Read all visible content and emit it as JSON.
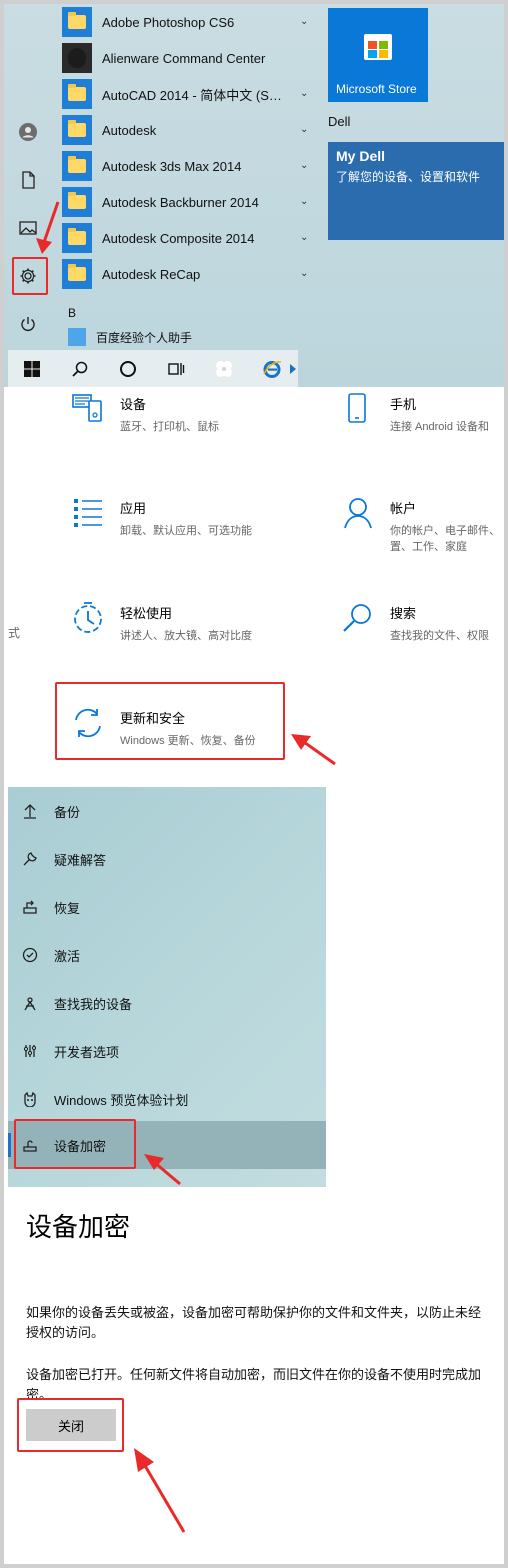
{
  "start_menu": {
    "apps": [
      {
        "label": "Adobe Photoshop CS6",
        "icon": "folder-icon",
        "expandable": true
      },
      {
        "label": "Alienware Command Center",
        "icon": "alienware-icon",
        "expandable": false
      },
      {
        "label": "AutoCAD 2014 - 简体中文 (Si...",
        "icon": "folder-icon",
        "expandable": true
      },
      {
        "label": "Autodesk",
        "icon": "folder-icon",
        "expandable": true
      },
      {
        "label": "Autodesk 3ds Max 2014",
        "icon": "folder-icon",
        "expandable": true
      },
      {
        "label": "Autodesk Backburner 2014",
        "icon": "folder-icon",
        "expandable": true
      },
      {
        "label": "Autodesk Composite 2014",
        "icon": "folder-icon",
        "expandable": true
      },
      {
        "label": "Autodesk ReCap",
        "icon": "folder-icon",
        "expandable": true
      }
    ],
    "section_letter": "B",
    "recent_item": "百度经验个人助手",
    "tiles": {
      "store_label": "Microsoft Store",
      "group_label": "Dell",
      "mydell_title": "My Dell",
      "mydell_subtitle": "了解您的设备、设置和软件"
    },
    "rail_icons": [
      "user-icon",
      "document-icon",
      "pictures-icon",
      "settings-gear-icon",
      "power-icon"
    ]
  },
  "settings": {
    "categories": [
      {
        "title": "设备",
        "subtitle": "蓝牙、打印机、鼠标",
        "icon": "devices-icon"
      },
      {
        "title": "手机",
        "subtitle": "连接 Android 设备和",
        "icon": "phone-icon"
      },
      {
        "title": "应用",
        "subtitle": "卸载、默认应用、可选功能",
        "icon": "apps-icon"
      },
      {
        "title": "帐户",
        "subtitle": "你的帐户、电子邮件、\n置、工作、家庭",
        "icon": "accounts-icon"
      },
      {
        "title": "轻松使用",
        "subtitle": "讲述人、放大镜、高对比度",
        "icon": "ease-of-access-icon"
      },
      {
        "title": "搜索",
        "subtitle": "查找我的文件、权限",
        "icon": "search-icon"
      },
      {
        "title": "更新和安全",
        "subtitle": "Windows 更新、恢复、备份",
        "icon": "update-security-icon"
      }
    ],
    "cut_text": "式"
  },
  "update_nav": {
    "items": [
      {
        "label": "备份",
        "icon": "backup-icon"
      },
      {
        "label": "疑难解答",
        "icon": "troubleshoot-icon"
      },
      {
        "label": "恢复",
        "icon": "recovery-icon"
      },
      {
        "label": "激活",
        "icon": "activation-icon"
      },
      {
        "label": "查找我的设备",
        "icon": "find-device-icon"
      },
      {
        "label": "开发者选项",
        "icon": "developer-icon"
      },
      {
        "label": "Windows 预览体验计划",
        "icon": "insider-icon"
      },
      {
        "label": "设备加密",
        "icon": "device-encryption-icon",
        "selected": true
      }
    ]
  },
  "encryption": {
    "title": "设备加密",
    "description": "如果你的设备丢失或被盗，设备加密可帮助保护你的文件和文件夹，以防止未经授权的访问。",
    "status": "设备加密已打开。任何新文件将自动加密，而旧文件在你的设备不使用时完成加密。",
    "button_label": "关闭"
  },
  "colors": {
    "accent": "#0a78d7",
    "annotation": "#ea2a2a",
    "selected_nav": "#94b3b8"
  }
}
